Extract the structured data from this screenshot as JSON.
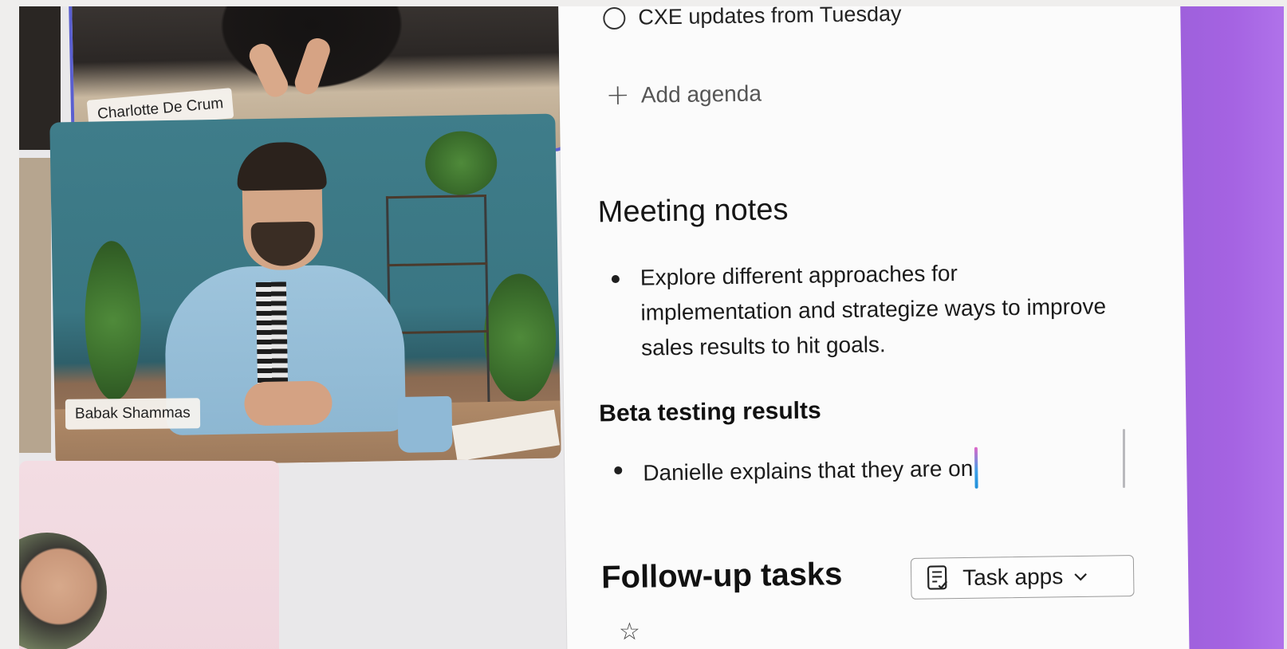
{
  "participants": [
    {
      "name": "Charlotte De Crum"
    },
    {
      "name": "Babak Shammas"
    }
  ],
  "agenda": {
    "item_partial": "CXE updates from Tuesday",
    "add_label": "Add agenda"
  },
  "notes": {
    "heading": "Meeting notes",
    "bullets": [
      "Explore different approaches for implementation and strategize ways to improve sales results to hit goals."
    ]
  },
  "beta": {
    "heading": "Beta testing results",
    "bullets": [
      "Danielle explains that they are on"
    ]
  },
  "followup": {
    "heading": "Follow-up tasks",
    "task_apps_label": "Task apps"
  },
  "colors": {
    "accent_purple": "#a563e2",
    "active_speaker_border": "#5a5fd0"
  }
}
